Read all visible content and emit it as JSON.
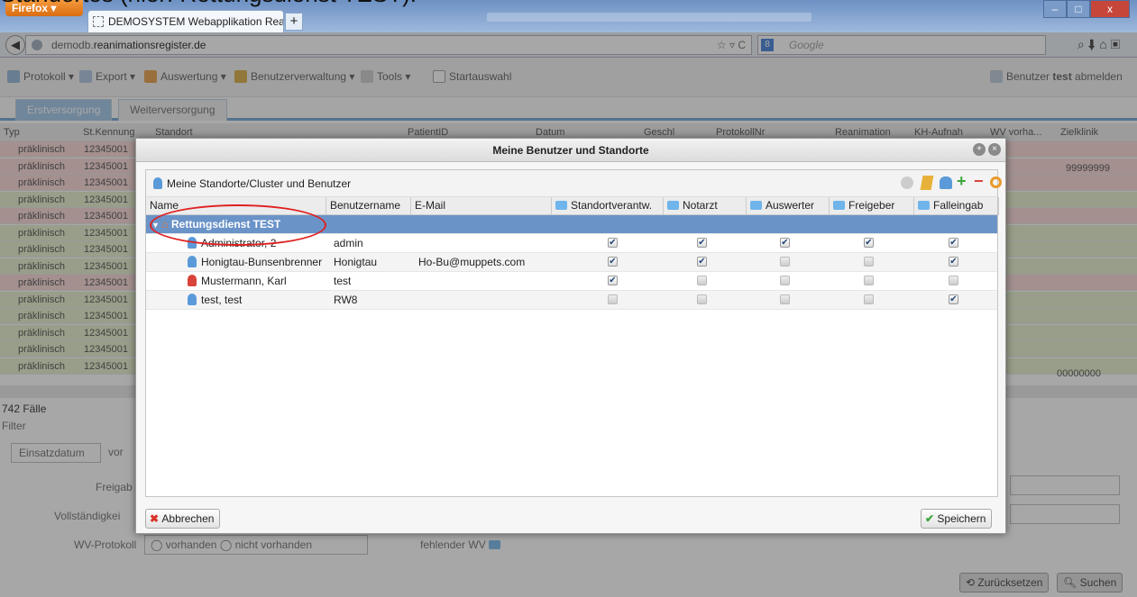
{
  "caption": "Standortes (hier: Rettungsdienst TEST).",
  "browser": {
    "app_button": "Firefox ▾",
    "tab_title": "DEMOSYSTEM Webapplikation Reanima...",
    "new_tab": "+",
    "url_prefix": "demodb.",
    "url_host": "reanimationsregister.de",
    "search_placeholder": "Google",
    "window_buttons": [
      "–",
      "□",
      "x"
    ]
  },
  "toolbar": {
    "items": [
      "Protokoll ▾",
      "Export ▾",
      "Auswertung ▾",
      "Benutzerverwaltung ▾",
      "Tools ▾",
      "Startauswahl"
    ],
    "logout_prefix": "Benutzer ",
    "logout_user": "test",
    "logout_suffix": " abmelden"
  },
  "tabs": [
    "Erstversorgung",
    "Weiterversorgung"
  ],
  "background": {
    "columns": [
      "Typ",
      "St.Kennung",
      "Standort",
      "PatientID",
      "Datum",
      "Geschl",
      "ProtokollNr",
      "Reanimation",
      "KH-Aufnah",
      "WV vorha...",
      "Zielklinik"
    ],
    "row_type": "präklinisch",
    "row_kennung": "12345001",
    "zielklinik_values": [
      "99999999",
      "00000000"
    ],
    "row_count": "742 Fälle",
    "filter_title": "Filter",
    "einsatzdatum": "Einsatzdatum",
    "vor_label": "vor",
    "freigabe_label": "Freigab",
    "vollstaendigkeit_label": "Vollständigkei",
    "wv_protokoll_label": "WV-Protokoll",
    "radio_vorhanden": "vorhanden",
    "radio_nicht_vorhanden": "nicht vorhanden",
    "fehlender_wv": "fehlender WV",
    "reset_button": "Zurücksetzen",
    "search_button": "Suchen"
  },
  "dialog": {
    "title": "Meine Benutzer und Standorte",
    "panel_title": "Meine Standorte/Cluster und Benutzer",
    "columns": [
      "Name",
      "Benutzername",
      "E-Mail",
      "Standortverantw.",
      "Notarzt",
      "Auswerter",
      "Freigeber",
      "Falleingab"
    ],
    "group": "Rettungsdienst TEST",
    "users": [
      {
        "name": "Administrator, 2",
        "username": "admin",
        "email": "",
        "icon_color": "#5b9ad8",
        "flags": [
          true,
          true,
          true,
          true,
          true
        ]
      },
      {
        "name": "Honigtau-Bunsenbrenner",
        "username": "Honigtau",
        "email": "Ho-Bu@muppets.com",
        "icon_color": "#5b9ad8",
        "flags": [
          true,
          true,
          false,
          false,
          true
        ]
      },
      {
        "name": "Mustermann, Karl",
        "username": "test",
        "email": "",
        "icon_color": "#d9433a",
        "flags": [
          true,
          false,
          false,
          false,
          false
        ]
      },
      {
        "name": "test, test",
        "username": "RW8",
        "email": "",
        "icon_color": "#5b9ad8",
        "flags": [
          false,
          false,
          false,
          false,
          true
        ]
      }
    ],
    "cancel_button": "Abbrechen",
    "save_button": "Speichern"
  },
  "colors": {
    "selected_row": "#6a93c8",
    "annotation_circle": "#e02020",
    "row_pink": "#f7d6d3",
    "row_green": "#e4efc8"
  }
}
